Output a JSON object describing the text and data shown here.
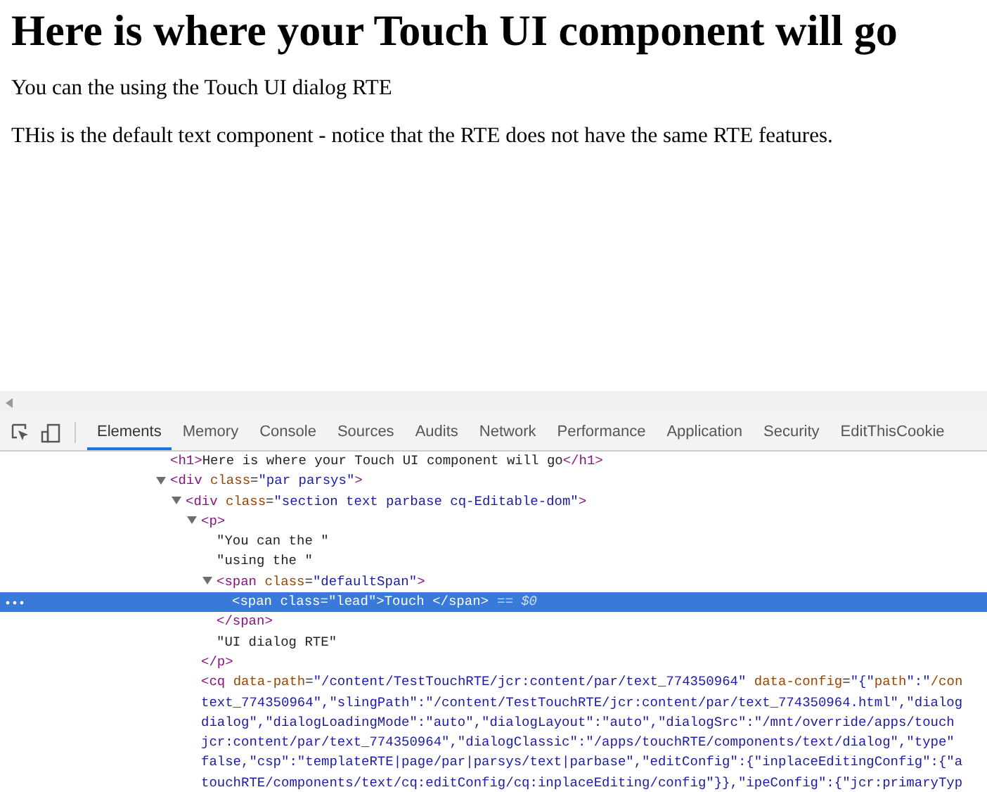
{
  "page": {
    "heading": "Here is where your Touch UI component will go",
    "paragraphs": [
      "You can the using the Touch UI dialog RTE",
      "THis is the default text component - notice that the RTE does not have the same RTE features."
    ]
  },
  "devtools": {
    "tabs": [
      {
        "label": "Elements",
        "selected": true
      },
      {
        "label": "Memory",
        "selected": false
      },
      {
        "label": "Console",
        "selected": false
      },
      {
        "label": "Sources",
        "selected": false
      },
      {
        "label": "Audits",
        "selected": false
      },
      {
        "label": "Network",
        "selected": false
      },
      {
        "label": "Performance",
        "selected": false
      },
      {
        "label": "Application",
        "selected": false
      },
      {
        "label": "Security",
        "selected": false
      },
      {
        "label": "EditThisCookie",
        "selected": false
      }
    ],
    "tree": [
      {
        "lines": [
          "<h1>Here is where your Touch UI component will go</h1>"
        ],
        "selected": false
      },
      {
        "lines": [
          "<div class=\"par parsys\">"
        ],
        "expanded": true,
        "selected": false,
        "children": [
          {
            "lines": [
              "<div class=\"section text parbase cq-Editable-dom\">"
            ],
            "expanded": true,
            "selected": false,
            "children": [
              {
                "lines": [
                  "<p>"
                ],
                "expanded": true,
                "selected": false,
                "close": "</p>",
                "children": [
                  {
                    "lines": [
                      "\"You can the \""
                    ],
                    "selected": false
                  },
                  {
                    "lines": [
                      "\"using the \""
                    ],
                    "selected": false
                  },
                  {
                    "lines": [
                      "<span class=\"defaultSpan\">"
                    ],
                    "expanded": true,
                    "selected": false,
                    "close": "</span>",
                    "children": [
                      {
                        "lines": [
                          "<span class=\"lead\">Touch </span>"
                        ],
                        "selected": true,
                        "suffix": "== $0"
                      }
                    ]
                  },
                  {
                    "lines": [
                      "\"UI dialog RTE\""
                    ],
                    "selected": false
                  }
                ]
              },
              {
                "lines": [
                  "<cq data-path=\"/content/TestTouchRTE/jcr:content/par/text_774350964\" data-config=\"{\"path\":\"/con",
                  "text_774350964\",\"slingPath\":\"/content/TestTouchRTE/jcr:content/par/text_774350964.html\",\"dialog",
                  "dialog\",\"dialogLoadingMode\":\"auto\",\"dialogLayout\":\"auto\",\"dialogSrc\":\"/mnt/override/apps/touch",
                  "jcr:content/par/text_774350964\",\"dialogClassic\":\"/apps/touchRTE/components/text/dialog\",\"type\"",
                  "false,\"csp\":\"templateRTE|page/par|parsys/text|parbase\",\"editConfig\":{\"inplaceEditingConfig\":{\"a",
                  "touchRTE/components/text/cq:editConfig/cq:inplaceEditing/config\"}},\"ipeConfig\":{\"jcr:primaryTyp"
                ],
                "selected": false
              }
            ]
          }
        ]
      }
    ]
  }
}
